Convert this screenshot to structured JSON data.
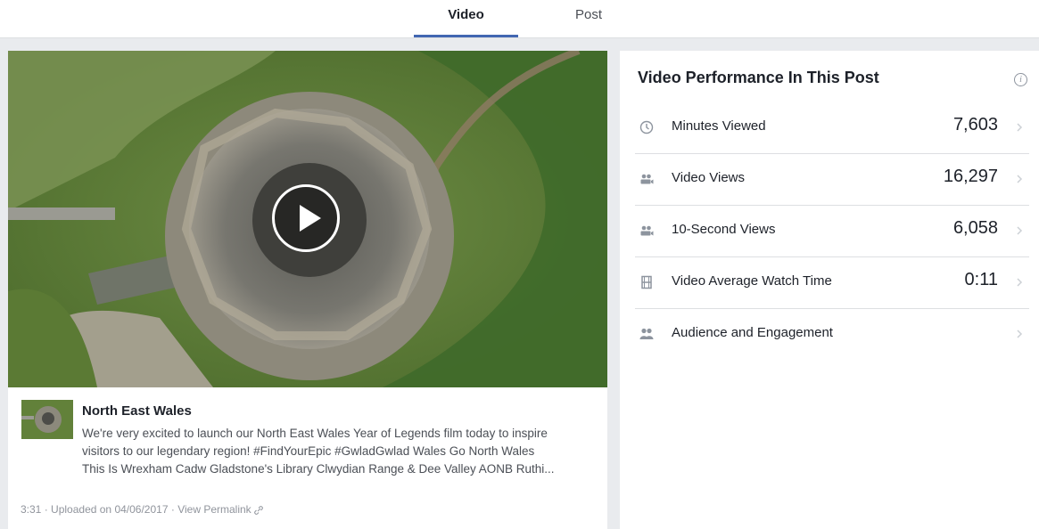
{
  "tabs": [
    {
      "label": "Video"
    },
    {
      "label": "Post"
    }
  ],
  "post": {
    "title": "North East Wales",
    "description_lines": [
      "We're very excited to launch our North East Wales Year of Legends film today to inspire",
      "visitors to our legendary region! #FindYourEpic #GwladGwlad Wales Go North Wales",
      "This Is Wrexham Cadw Gladstone's Library Clwydian Range & Dee Valley AONB Ruthi..."
    ],
    "duration": "3:31",
    "separator": "·",
    "uploaded": "Uploaded on 04/06/2017",
    "permalink": "View Permalink"
  },
  "performance": {
    "title": "Video Performance In This Post",
    "info_glyph": "i",
    "metrics": [
      {
        "icon": "clock-icon",
        "label": "Minutes Viewed",
        "value": "7,603"
      },
      {
        "icon": "viewers-icon",
        "label": "Video Views",
        "value": "16,297"
      },
      {
        "icon": "viewers-icon",
        "label": "10-Second Views",
        "value": "6,058"
      },
      {
        "icon": "film-icon",
        "label": "Video Average Watch Time",
        "value": "0:11"
      },
      {
        "icon": "people-icon",
        "label": "Audience and Engagement",
        "value": ""
      }
    ]
  },
  "colors": {
    "accent": "#4267b2",
    "page_bg": "#e9ebee",
    "icon_grey": "#8d949e"
  }
}
